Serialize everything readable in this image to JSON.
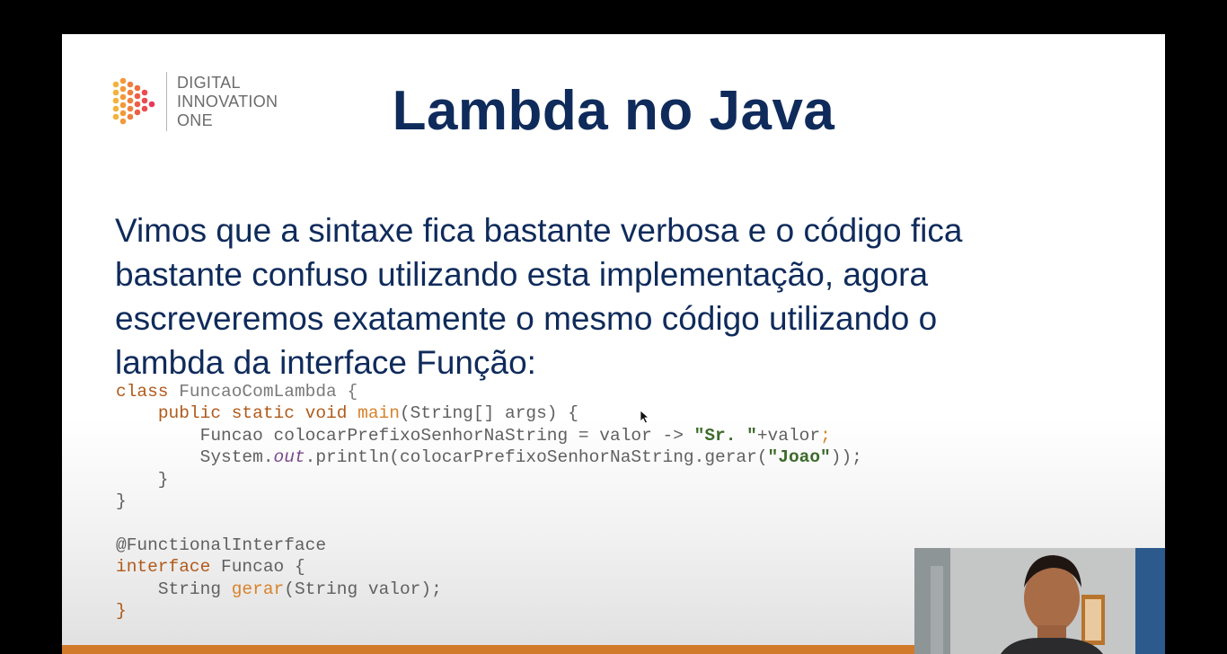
{
  "logo": {
    "line1": "DIGITAL",
    "line2": "INNOVATION",
    "line3": "ONE",
    "colors": [
      "#f4b13a",
      "#ec6f3c",
      "#e8385c"
    ]
  },
  "title": "Lambda no Java",
  "paragraph": {
    "line1": "Vimos que a sintaxe fica bastante verbosa e o código fica",
    "line2": "bastante confuso utilizando esta implementação, agora",
    "line3": "escreveremos exatamente o mesmo código utilizando o",
    "line4": "lambda da interface Função:"
  },
  "code": {
    "l1_kw": "class",
    "l1_name": " FuncaoComLambda {",
    "l2_indent": "    ",
    "l2_kw": "public static void ",
    "l2_fn": "main",
    "l2_rest": "(String[] args) {",
    "l3_indent": "        ",
    "l3_text": "Funcao colocarPrefixoSenhorNaString = valor -> ",
    "l3_str": "\"Sr. \"",
    "l3_rest": "+valor",
    "l3_semi": ";",
    "l4_indent": "        ",
    "l4_a": "System.",
    "l4_out": "out",
    "l4_b": ".println(colocarPrefixoSenhorNaString.gerar(",
    "l4_str": "\"Joao\"",
    "l4_c": "));",
    "l5": "    }",
    "l6": "}",
    "l8": "@FunctionalInterface",
    "l9_kw": "interface",
    "l9_rest": " Funcao {",
    "l10_indent": "    ",
    "l10_a": "String ",
    "l10_fn": "gerar",
    "l10_b": "(String valor);",
    "l11": "}"
  },
  "colors": {
    "title": "#0f2b5b",
    "accent_bar": "#d07a2a"
  }
}
